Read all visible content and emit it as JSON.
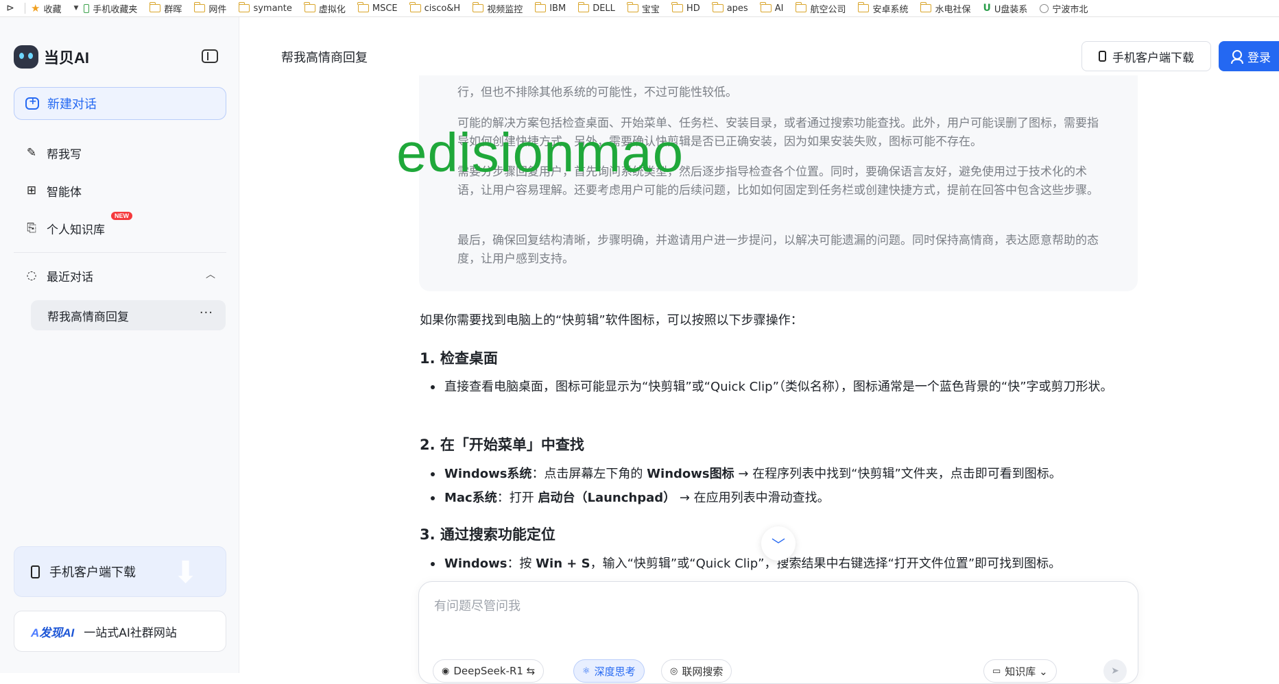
{
  "bookmarks_bar": {
    "items": [
      {
        "label": "收藏",
        "icon": "star-icon"
      },
      {
        "label": "手机收藏夹",
        "icon": "phone-icon"
      },
      {
        "label": "群晖",
        "icon": "folder-icon"
      },
      {
        "label": "网件",
        "icon": "folder-icon"
      },
      {
        "label": "symante",
        "icon": "folder-icon"
      },
      {
        "label": "虚拟化",
        "icon": "folder-icon"
      },
      {
        "label": "MSCE",
        "icon": "folder-icon"
      },
      {
        "label": "cisco&H",
        "icon": "folder-icon"
      },
      {
        "label": "视频监控",
        "icon": "folder-icon"
      },
      {
        "label": "IBM",
        "icon": "folder-icon"
      },
      {
        "label": "DELL",
        "icon": "folder-icon"
      },
      {
        "label": "宝宝",
        "icon": "folder-icon"
      },
      {
        "label": "HD",
        "icon": "folder-icon"
      },
      {
        "label": "apes",
        "icon": "folder-icon"
      },
      {
        "label": "AI",
        "icon": "folder-icon"
      },
      {
        "label": "航空公司",
        "icon": "folder-icon"
      },
      {
        "label": "安卓系统",
        "icon": "folder-icon"
      },
      {
        "label": "水电社保",
        "icon": "folder-icon"
      },
      {
        "label": "U盘装系",
        "icon": "u-icon"
      },
      {
        "label": "宁波市北",
        "icon": "globe-icon"
      }
    ]
  },
  "sidebar": {
    "app_name": "当贝AI",
    "new_chat_label": "新建对话",
    "nav": [
      {
        "label": "帮我写",
        "icon": "pen-icon"
      },
      {
        "label": "智能体",
        "icon": "grid-icon"
      },
      {
        "label": "个人知识库",
        "icon": "knowledge-icon",
        "badge": "NEW"
      }
    ],
    "recent_label": "最近对话",
    "recent_items": [
      {
        "label": "帮我高情商回复"
      }
    ],
    "more_symbol": "···",
    "app_download_label": "手机客户端下载",
    "promo": {
      "logo_main": "A",
      "logo_text": "发现AI",
      "label": "一站式AI社群网站"
    }
  },
  "header": {
    "title": "帮我高情商回复",
    "app_download_label": "手机客户端下载",
    "login_label": "登录"
  },
  "thinking": {
    "paragraphs": [
      "行，但也不排除其他系统的可能性，不过可能性较低。",
      "可能的解决方案包括检查桌面、开始菜单、任务栏、安装目录，或者通过搜索功能查找。此外，用户可能误删了图标，需要指导如何创建快捷方式。另外，需要确认快剪辑是否已正确安装，因为如果安装失败，图标可能不存在。",
      "需要分步骤回复用户，首先询问系统类型，然后逐步指导检查各个位置。同时，要确保语言友好，避免使用过于技术化的术语，让用户容易理解。还要考虑用户可能的后续问题，比如如何固定到任务栏或创建快捷方式，提前在回答中包含这些步骤。",
      "最后，确保回复结构清晰，步骤明确，并邀请用户进一步提问，以解决可能遗漏的问题。同时保持高情商，表达愿意帮助的态度，让用户感到支持。"
    ]
  },
  "watermark": "edisionmao",
  "answer": {
    "intro": "如果你需要找到电脑上的“快剪辑”软件图标，可以按照以下步骤操作：",
    "sections": [
      {
        "heading": "1. 检查桌面",
        "bullets": [
          {
            "text": "直接查看电脑桌面，图标可能显示为“快剪辑”或“Quick Clip”（类似名称），图标通常是一个蓝色背景的“快”字或剪刀形状。"
          }
        ]
      },
      {
        "heading": "2. 在「开始菜单」中查找",
        "bullets": [
          {
            "bold": "Windows系统",
            "t1": "：点击屏幕左下角的 ",
            "bold2": "Windows图标",
            "t2": " → 在程序列表中找到“快剪辑”文件夹，点击即可看到图标。"
          },
          {
            "bold": "Mac系统",
            "t1": "：打开 ",
            "bold2": "启动台（Launchpad）",
            "t2": " → 在应用列表中滑动查找。"
          }
        ]
      },
      {
        "heading": "3. 通过搜索功能定位",
        "bullets": [
          {
            "bold": "Windows",
            "t1": "：按 ",
            "bold2": "Win + S",
            "t2": "，输入“快剪辑”或“Quick Clip”，搜索结果中右键选择“打开文件位置”即可找到图标。"
          }
        ]
      }
    ]
  },
  "composer": {
    "placeholder": "有问题尽管问我",
    "chips": [
      {
        "label": "DeepSeek-R1 ⇆",
        "icon": "deepseek-icon",
        "active": false
      },
      {
        "label": "深度思考",
        "icon": "brain-icon",
        "active": true
      },
      {
        "label": "联网搜索",
        "icon": "globe-icon",
        "active": false
      },
      {
        "label": "知识库 ⌄",
        "icon": "folder-icon",
        "active": false
      }
    ]
  },
  "colors": {
    "accent": "#2468f2",
    "watermark": "#1fa83a",
    "sidebar_bg": "#f8f9fb",
    "badge": "#f5393c"
  }
}
